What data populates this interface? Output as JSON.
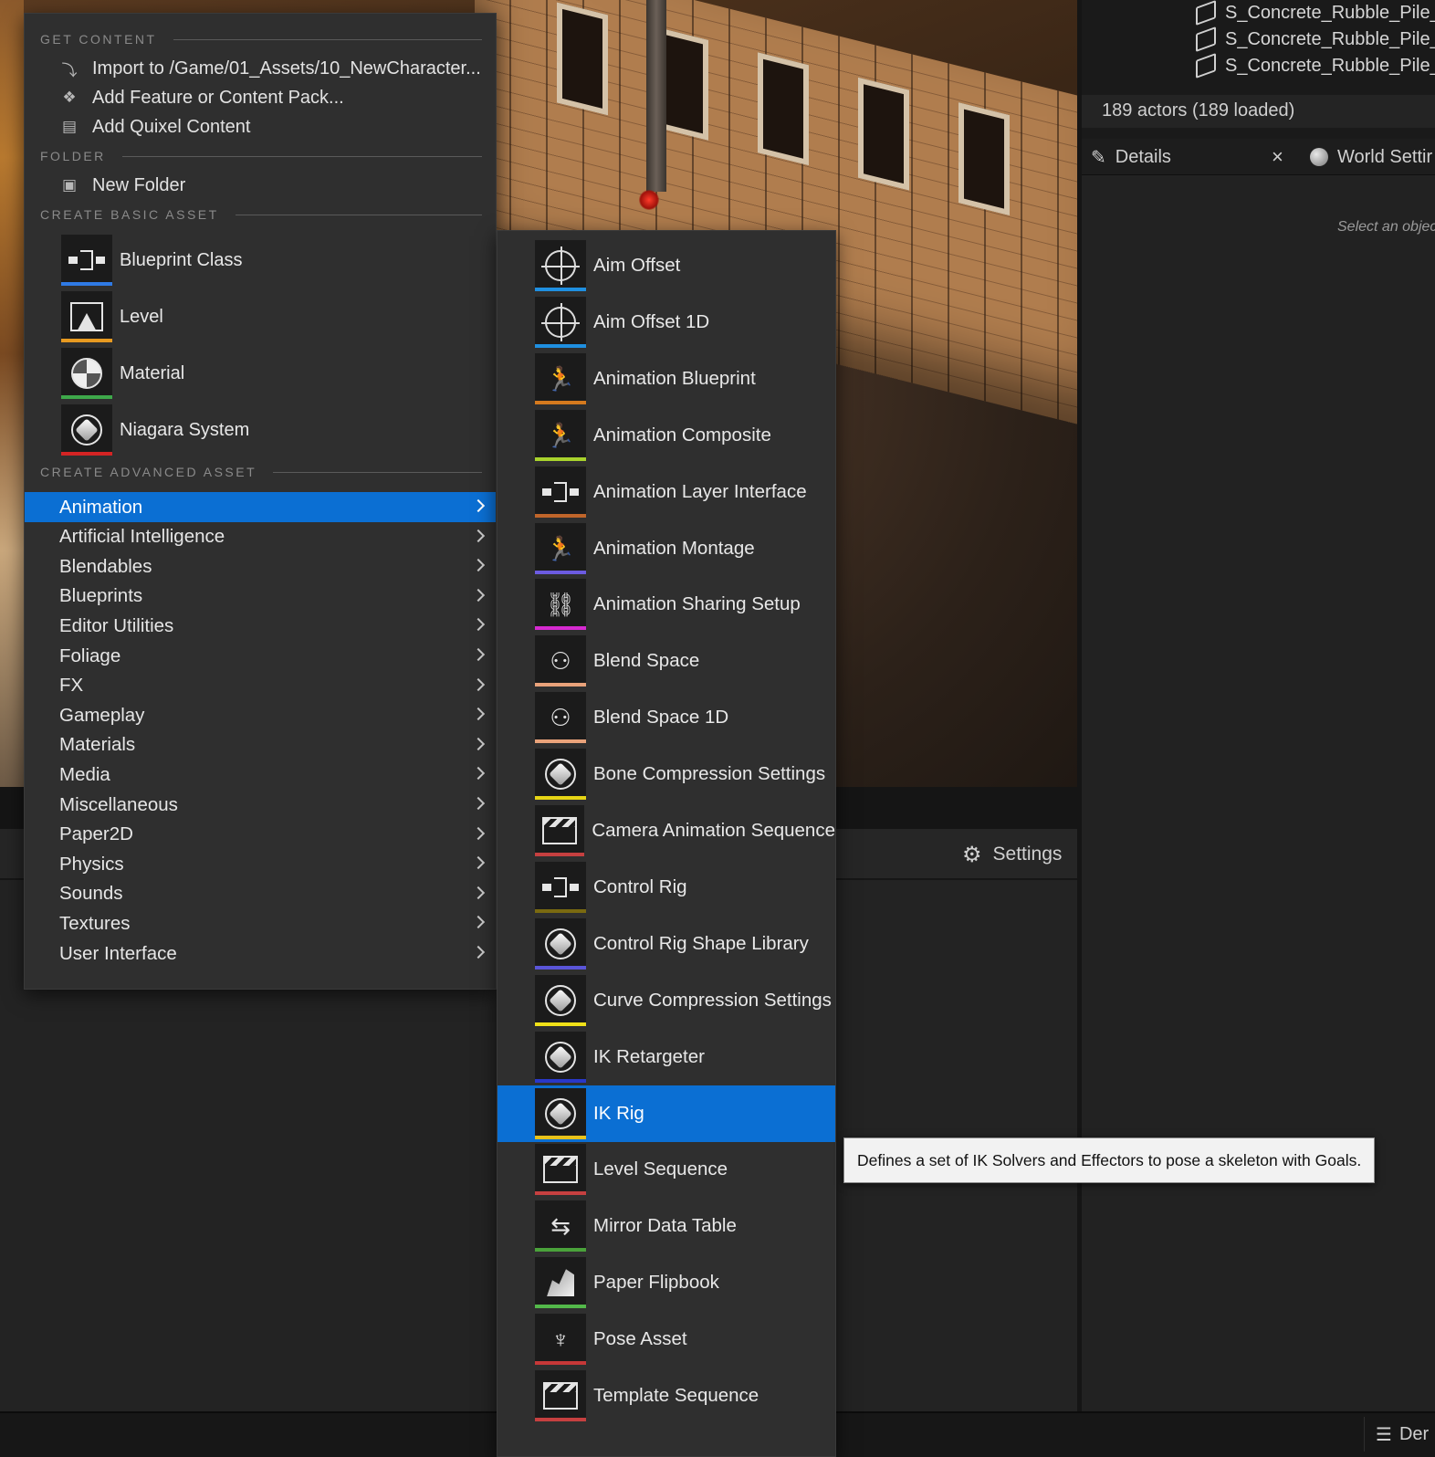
{
  "outliner": {
    "rows": [
      "S_Concrete_Rubble_Pile_t",
      "S_Concrete_Rubble_Pile_t",
      "S_Concrete_Rubble_Pile_t"
    ],
    "actors_count": "189 actors (189 loaded)"
  },
  "details": {
    "tab_details": "Details",
    "tab_close": "×",
    "tab_world": "World Settir",
    "hint": "Select an objec"
  },
  "lower": {
    "settings_label": "Settings"
  },
  "status": {
    "right_label": "Der"
  },
  "menu": {
    "sections": {
      "get_content": "GET CONTENT",
      "folder": "FOLDER",
      "create_basic": "CREATE BASIC ASSET",
      "create_advanced": "CREATE ADVANCED ASSET"
    },
    "get_content_items": [
      {
        "label": "Import to /Game/01_Assets/10_NewCharacter...",
        "icon": "import-icon"
      },
      {
        "label": "Add Feature or Content Pack...",
        "icon": "content-pack-icon"
      },
      {
        "label": "Add Quixel Content",
        "icon": "quixel-icon"
      }
    ],
    "folder_items": [
      {
        "label": "New Folder",
        "icon": "new-folder-icon"
      }
    ],
    "basic_items": [
      {
        "label": "Blueprint Class",
        "icon": "blueprint-icon",
        "color": "#2f7ae5"
      },
      {
        "label": "Level",
        "icon": "level-icon",
        "color": "#e79a21"
      },
      {
        "label": "Material",
        "icon": "material-icon",
        "color": "#3ea84a"
      },
      {
        "label": "Niagara System",
        "icon": "niagara-icon",
        "color": "#d42424"
      }
    ],
    "advanced_items": [
      {
        "label": "Animation",
        "active": true
      },
      {
        "label": "Artificial Intelligence"
      },
      {
        "label": "Blendables"
      },
      {
        "label": "Blueprints"
      },
      {
        "label": "Editor Utilities"
      },
      {
        "label": "Foliage"
      },
      {
        "label": "FX"
      },
      {
        "label": "Gameplay"
      },
      {
        "label": "Materials"
      },
      {
        "label": "Media"
      },
      {
        "label": "Miscellaneous"
      },
      {
        "label": "Paper2D"
      },
      {
        "label": "Physics"
      },
      {
        "label": "Sounds"
      },
      {
        "label": "Textures"
      },
      {
        "label": "User Interface"
      }
    ]
  },
  "submenu": {
    "items": [
      {
        "label": "Aim Offset",
        "icon": "crosshair-icon",
        "color": "#1f8fe0"
      },
      {
        "label": "Aim Offset 1D",
        "icon": "crosshair-icon",
        "color": "#1f8fe0"
      },
      {
        "label": "Animation Blueprint",
        "icon": "anim-blueprint-icon",
        "color": "#d57a1e"
      },
      {
        "label": "Animation Composite",
        "icon": "anim-composite-icon",
        "color": "#a8d22c"
      },
      {
        "label": "Animation Layer Interface",
        "icon": "node-graph-icon",
        "color": "#c0652a"
      },
      {
        "label": "Animation Montage",
        "icon": "anim-montage-icon",
        "color": "#6c5be0"
      },
      {
        "label": "Animation Sharing Setup",
        "icon": "anim-sharing-icon",
        "color": "#d62ad0"
      },
      {
        "label": "Blend Space",
        "icon": "blend-space-icon",
        "color": "#e9a27a"
      },
      {
        "label": "Blend Space 1D",
        "icon": "blend-space-icon",
        "color": "#e9a27a"
      },
      {
        "label": "Bone Compression Settings",
        "icon": "sphere-icon",
        "color": "#e6d415"
      },
      {
        "label": "Camera Animation Sequence",
        "icon": "clapper-icon",
        "color": "#c64040"
      },
      {
        "label": "Control Rig",
        "icon": "node-graph-icon",
        "color": "#7a6a10"
      },
      {
        "label": "Control Rig Shape Library",
        "icon": "sphere-icon",
        "color": "#5a55d8"
      },
      {
        "label": "Curve Compression Settings",
        "icon": "sphere-icon",
        "color": "#f0e118"
      },
      {
        "label": "IK Retargeter",
        "icon": "sphere-icon",
        "color": "#2a38c8"
      },
      {
        "label": "IK Rig",
        "icon": "sphere-icon",
        "color": "#e8c21a",
        "active": true
      },
      {
        "label": "Level Sequence",
        "icon": "clapper-icon",
        "color": "#c64040"
      },
      {
        "label": "Mirror Data Table",
        "icon": "mirror-icon",
        "color": "#4aa23a"
      },
      {
        "label": "Paper Flipbook",
        "icon": "flipbook-icon",
        "color": "#53b84a"
      },
      {
        "label": "Pose Asset",
        "icon": "pose-icon",
        "color": "#c63838"
      },
      {
        "label": "Template Sequence",
        "icon": "clapper-icon",
        "color": "#c64040"
      }
    ]
  },
  "tooltip": {
    "text": "Defines a set of IK Solvers and Effectors to pose a skeleton with Goals."
  }
}
